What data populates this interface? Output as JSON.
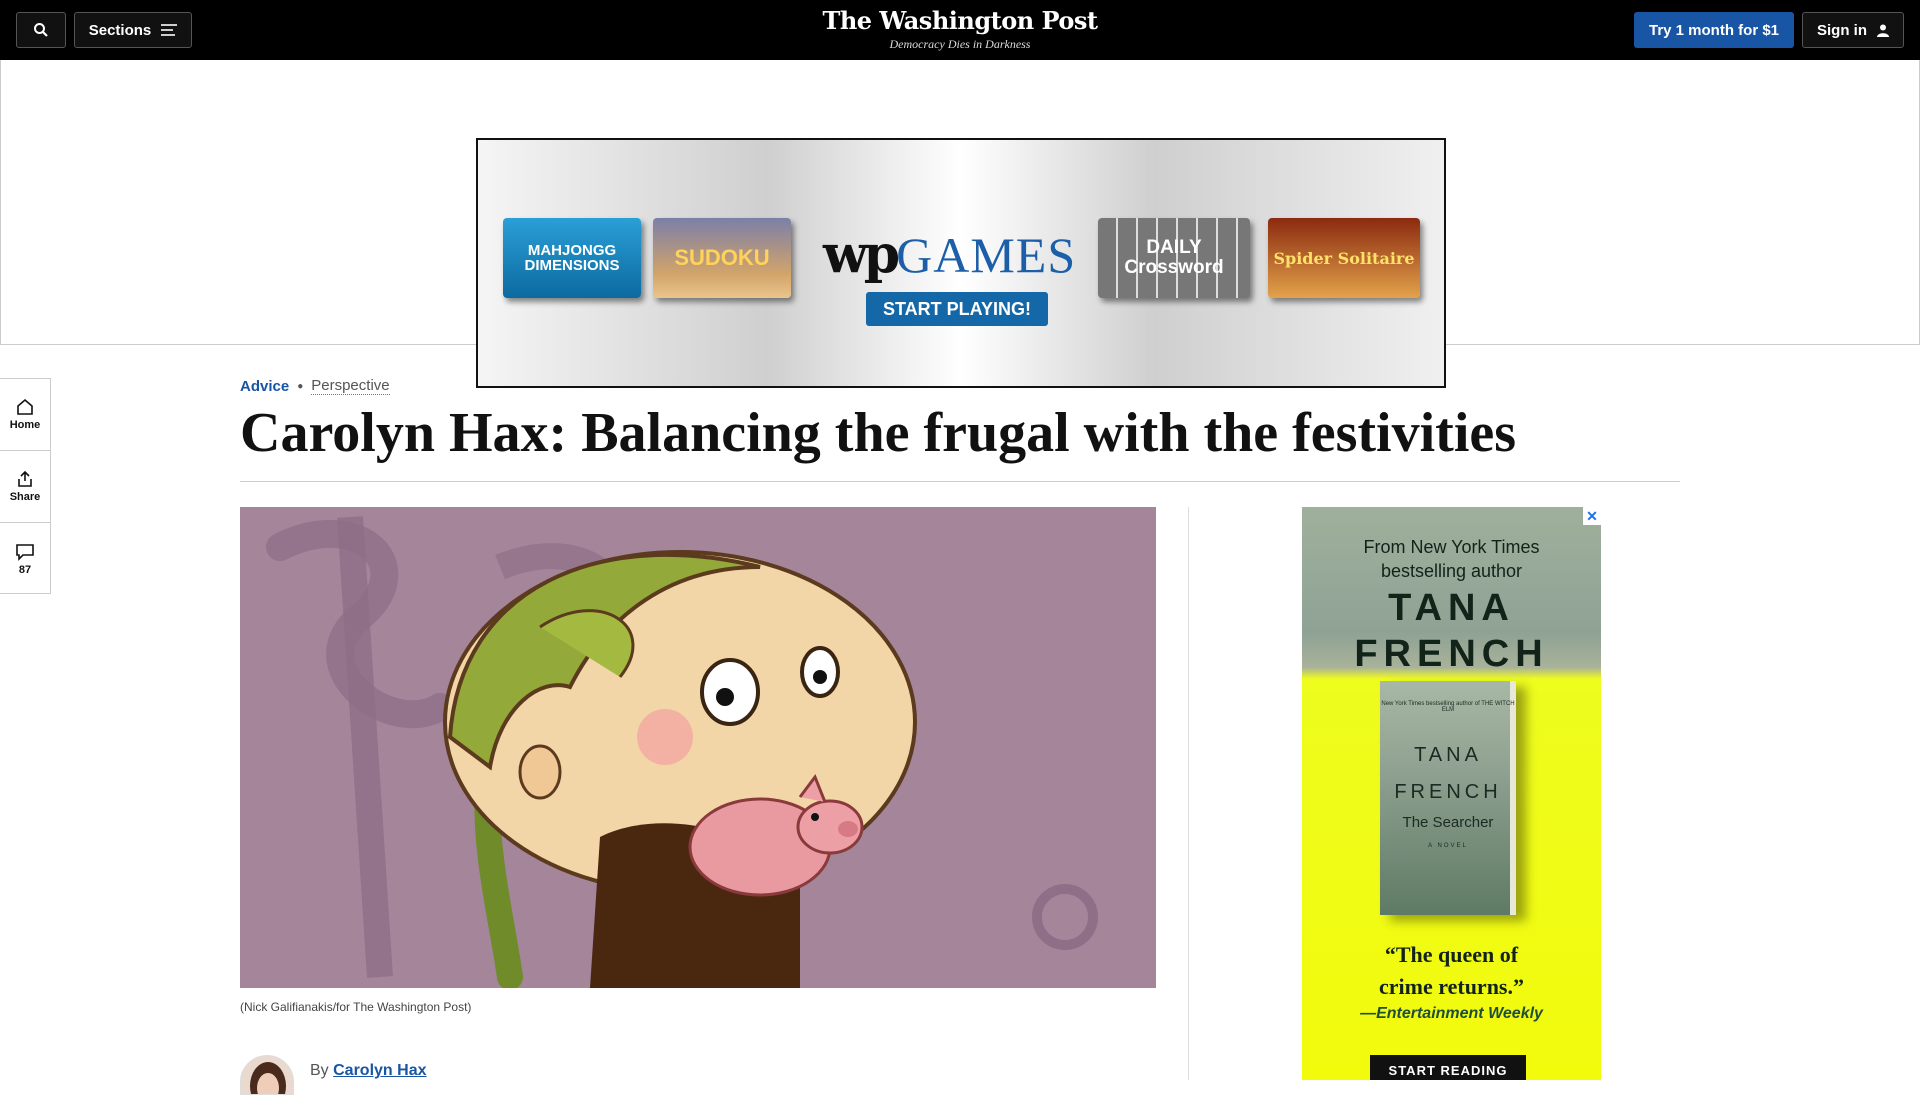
{
  "header": {
    "sections_label": "Sections",
    "logo_text": "The Washington Post",
    "tagline": "Democracy Dies in Darkness",
    "trial_label": "Try 1 month for $1",
    "signin_label": "Sign in"
  },
  "top_ad": {
    "tiles": {
      "mahjong": "MAHJONGG DIMENSIONS",
      "sudoku": "SUDOKU",
      "crossword": "DAILY Crossword",
      "solitaire": "Spider Solitaire"
    },
    "brand_mark": "wp",
    "brand_games": "GAMES",
    "cta": "START PLAYING!"
  },
  "rail": {
    "home": "Home",
    "share": "Share",
    "comments_count": "87"
  },
  "article": {
    "section": "Advice",
    "label": "Perspective",
    "headline": "Carolyn Hax: Balancing the frugal with the festivities",
    "image_caption": "(Nick Galifianakis/for The Washington Post)",
    "byline_prefix": "By",
    "author": "Carolyn Hax"
  },
  "side_ad": {
    "from_line1": "From New York Times",
    "from_line2": "bestselling author",
    "author_line1": "TANA",
    "author_line2": "FRENCH",
    "cover_small": "New York Times bestselling author of THE WITCH ELM",
    "cover_author1": "TANA",
    "cover_author2": "FRENCH",
    "cover_title": "The Searcher",
    "cover_novel": "A NOVEL",
    "quote_line1": "“The queen of",
    "quote_line2": "crime returns.”",
    "quote_source": "—Entertainment Weekly",
    "cta": "START READING",
    "close_glyph": "✕"
  },
  "colors": {
    "accent": "#1955a5",
    "topbar": "#000000",
    "image_bg": "#a4859a",
    "ad_yellow": "#f2fb0c"
  }
}
